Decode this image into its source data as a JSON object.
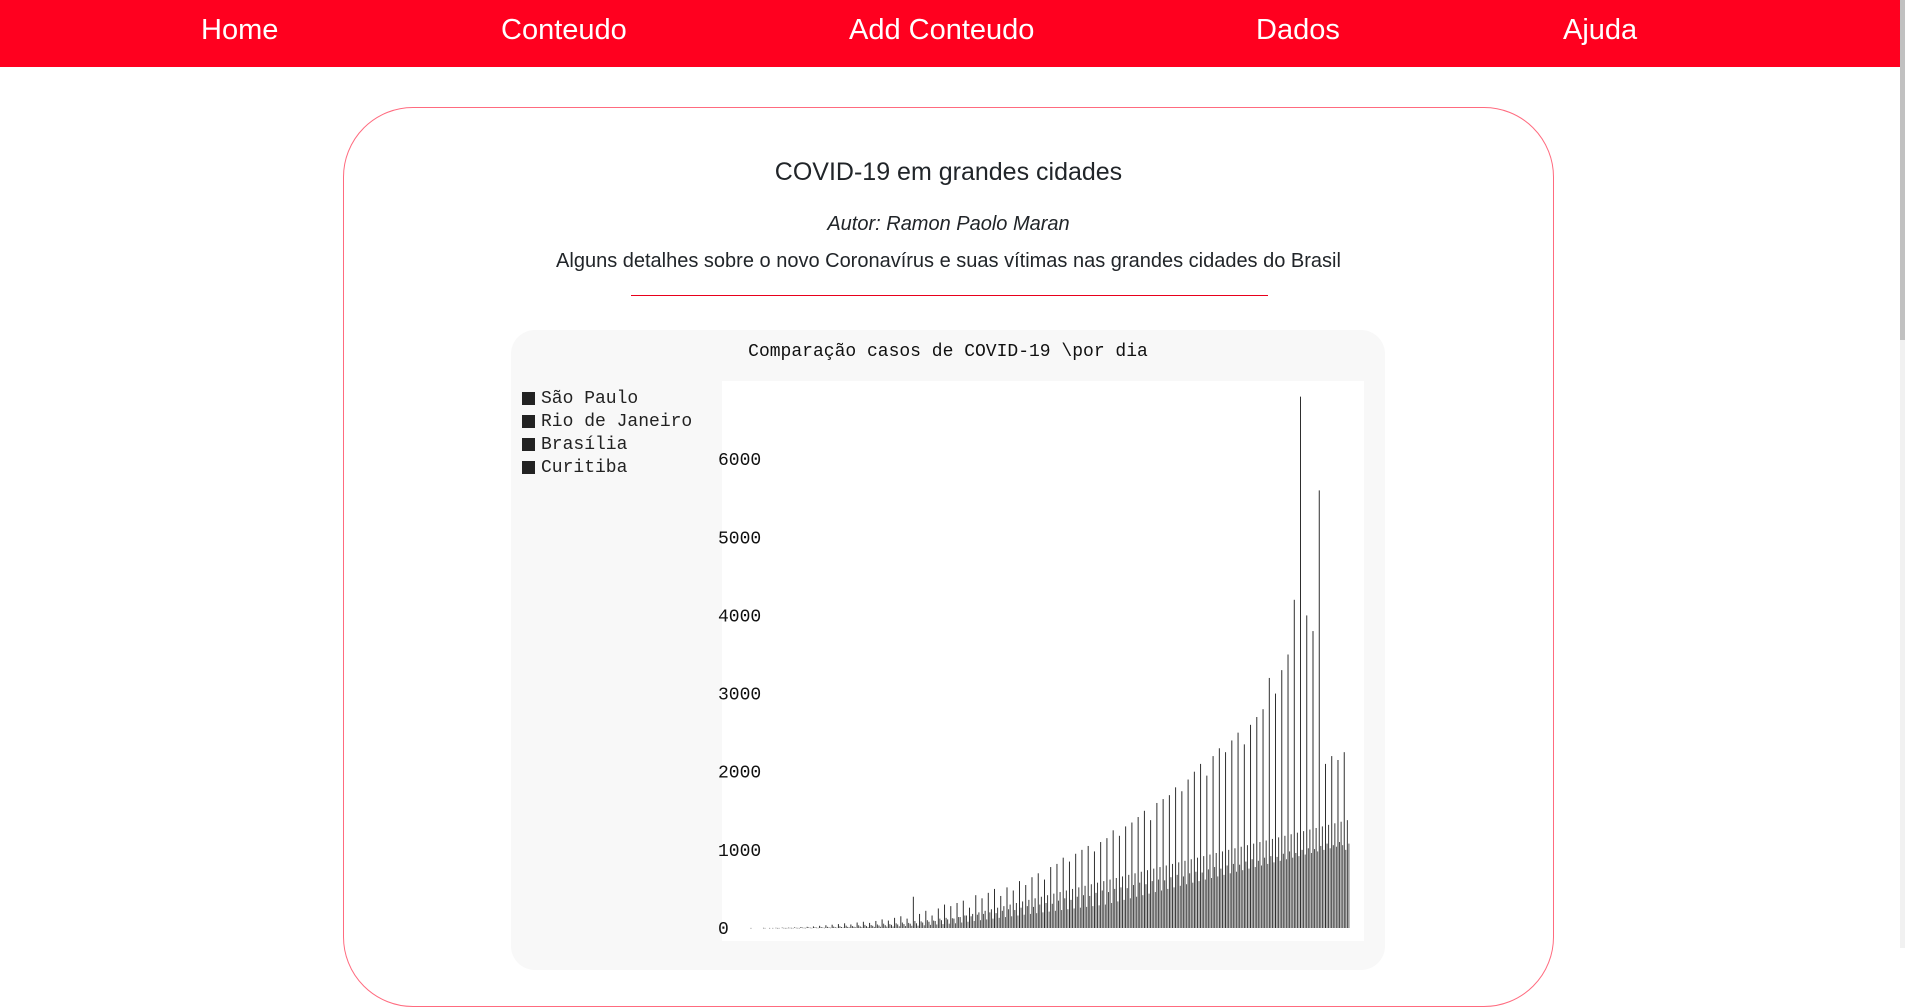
{
  "nav": {
    "items": [
      "Home",
      "Conteudo",
      "Add Conteudo",
      "Dados",
      "Ajuda"
    ]
  },
  "article": {
    "title": "COVID-19 em grandes cidades",
    "author": "Autor: Ramon Paolo Maran",
    "description": "Alguns detalhes sobre o novo Coronavírus e suas vítimas nas grandes cidades do Brasil"
  },
  "colors": {
    "nav_background": "#ff001f",
    "nav_text": "#ffffff",
    "card_border": "#ff6b7f",
    "divider": "#e8001c",
    "bars": "#222222"
  },
  "chart_data": {
    "type": "bar",
    "title": "Comparação casos de COVID-19 \\por dia",
    "xlabel": "",
    "ylabel": "",
    "ylim": [
      0,
      7000
    ],
    "yticks": [
      0,
      1000,
      2000,
      3000,
      4000,
      5000,
      6000
    ],
    "grid": false,
    "legend_position": "left",
    "series": [
      {
        "name": "São Paulo",
        "values": [
          0,
          0,
          1,
          0,
          2,
          1,
          3,
          5,
          4,
          8,
          12,
          15,
          20,
          28,
          35,
          42,
          50,
          60,
          45,
          70,
          80,
          65,
          90,
          110,
          95,
          130,
          150,
          120,
          400,
          180,
          220,
          160,
          250,
          300,
          280,
          320,
          350,
          260,
          420,
          380,
          450,
          500,
          410,
          520,
          480,
          600,
          550,
          650,
          700,
          620,
          780,
          820,
          900,
          850,
          950,
          1000,
          1050,
          980,
          1100,
          1150,
          1250,
          1180,
          1300,
          1350,
          1420,
          1500,
          1380,
          1600,
          1650,
          1700,
          1800,
          1750,
          1900,
          2000,
          2100,
          1950,
          2200,
          2300,
          2250,
          2400,
          2500,
          2350,
          2600,
          2700,
          2800,
          3200,
          3000,
          3300,
          3500,
          4200,
          6800,
          4000,
          3800,
          5600,
          2100,
          2200,
          2150,
          2250
        ]
      },
      {
        "name": "Rio de Janeiro",
        "values": [
          0,
          0,
          0,
          0,
          1,
          0,
          1,
          2,
          3,
          3,
          5,
          8,
          10,
          12,
          15,
          18,
          22,
          30,
          25,
          35,
          40,
          38,
          45,
          55,
          50,
          60,
          70,
          65,
          90,
          85,
          100,
          95,
          120,
          130,
          125,
          140,
          160,
          150,
          170,
          180,
          200,
          190,
          220,
          240,
          230,
          260,
          280,
          270,
          300,
          320,
          310,
          350,
          380,
          360,
          400,
          420,
          410,
          450,
          480,
          460,
          500,
          520,
          510,
          550,
          580,
          560,
          600,
          620,
          610,
          650,
          680,
          660,
          700,
          720,
          710,
          750,
          780,
          760,
          800,
          820,
          810,
          850,
          880,
          860,
          900,
          920,
          910,
          950,
          980,
          960,
          1000,
          1020,
          1010,
          1050,
          1080,
          1060,
          1100,
          1000
        ]
      },
      {
        "name": "Brasília",
        "values": [
          0,
          0,
          0,
          0,
          0,
          1,
          1,
          1,
          2,
          2,
          3,
          4,
          5,
          6,
          8,
          10,
          12,
          14,
          16,
          20,
          24,
          28,
          32,
          36,
          40,
          45,
          50,
          55,
          60,
          70,
          80,
          90,
          100,
          110,
          120,
          140,
          160,
          180,
          200,
          220,
          240,
          260,
          280,
          300,
          320,
          340,
          360,
          380,
          400,
          420,
          440,
          460,
          480,
          500,
          520,
          540,
          560,
          580,
          600,
          620,
          640,
          660,
          680,
          700,
          720,
          740,
          760,
          780,
          800,
          820,
          840,
          860,
          880,
          900,
          920,
          940,
          960,
          980,
          1000,
          1020,
          1040,
          1060,
          1080,
          1100,
          1120,
          1140,
          1160,
          1180,
          1200,
          1220,
          1240,
          1260,
          1280,
          1300,
          1320,
          1340,
          1360,
          1380
        ]
      },
      {
        "name": "Curitiba",
        "values": [
          0,
          0,
          0,
          0,
          0,
          0,
          0,
          1,
          1,
          1,
          2,
          2,
          3,
          3,
          4,
          5,
          6,
          7,
          8,
          10,
          12,
          14,
          16,
          18,
          20,
          22,
          25,
          28,
          30,
          35,
          40,
          45,
          50,
          55,
          60,
          70,
          80,
          90,
          100,
          110,
          120,
          130,
          140,
          150,
          160,
          170,
          180,
          190,
          200,
          210,
          220,
          230,
          240,
          250,
          260,
          270,
          280,
          290,
          300,
          320,
          340,
          360,
          380,
          400,
          420,
          440,
          460,
          480,
          500,
          520,
          540,
          560,
          580,
          600,
          620,
          640,
          660,
          680,
          700,
          720,
          740,
          760,
          780,
          800,
          820,
          840,
          860,
          880,
          900,
          920,
          940,
          960,
          980,
          1000,
          1020,
          1040,
          1060,
          1080
        ]
      }
    ]
  }
}
